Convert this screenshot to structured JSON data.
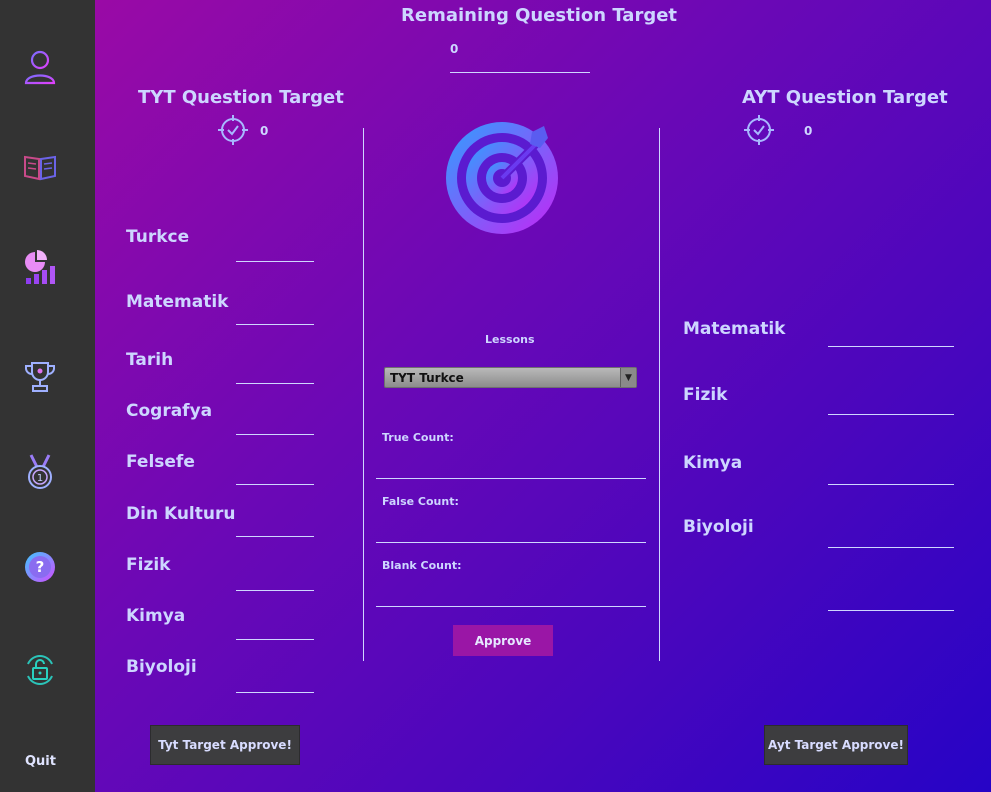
{
  "sidebar": {
    "icons": [
      "user-icon",
      "book-icon",
      "chart-icon",
      "trophy-icon",
      "medal-icon",
      "help-icon",
      "lock-icon"
    ],
    "quit_label": "Quit"
  },
  "header": {
    "remaining_title": "Remaining Question Target",
    "remaining_value": "0"
  },
  "tyt": {
    "title": "TYT Question Target",
    "count": "0",
    "lessons": [
      "Turkce",
      "Matematik",
      "Tarih",
      "Cografya",
      "Felsefe",
      "Din Kulturu",
      "Fizik",
      "Kimya",
      "Biyoloji"
    ],
    "approve_label": "Tyt Target Approve!"
  },
  "ayt": {
    "title": "AYT Question Target",
    "count": "0",
    "lessons": [
      "Matematik",
      "Fizik",
      "Kimya",
      "Biyoloji"
    ],
    "approve_label": "Ayt Target Approve!"
  },
  "center": {
    "lessons_label": "Lessons",
    "selected_lesson": "TYT Turkce",
    "true_label": "True Count:",
    "false_label": "False Count:",
    "blank_label": "Blank Count:",
    "approve_label": "Approve"
  },
  "colors": {
    "sidebar_bg": "#333333",
    "gradient_start": "#9a0aa6",
    "gradient_end": "#2604c6",
    "text": "#cdd6ff",
    "approve_button": "#9a16a6"
  }
}
